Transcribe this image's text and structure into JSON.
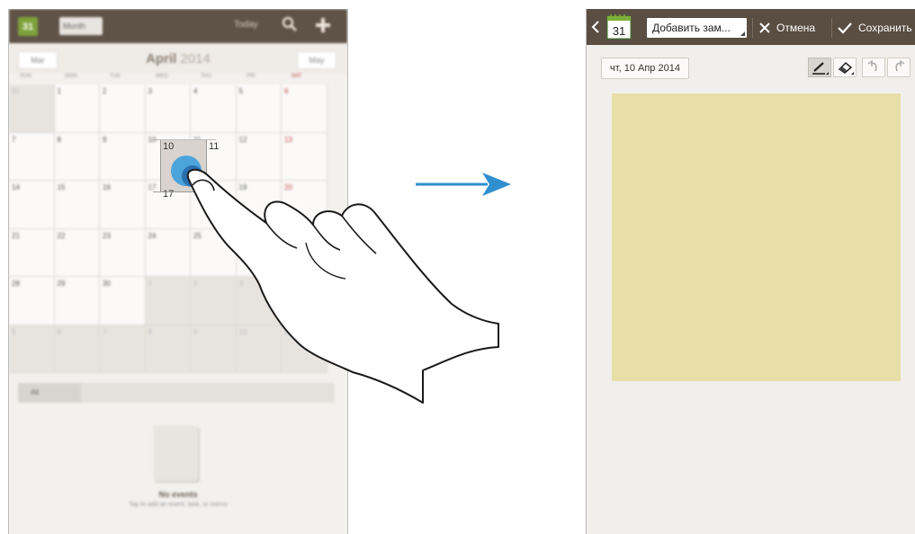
{
  "calendar": {
    "app_icon_day": "31",
    "view_selector": "Month",
    "today_label": "Today",
    "prev_month": "Mar",
    "next_month": "May",
    "month_title": "April",
    "month_year": "2014",
    "weekdays": [
      "SUN",
      "MON",
      "TUE",
      "WED",
      "THU",
      "FRI",
      "SAT"
    ],
    "weeks": [
      [
        "31",
        "1",
        "2",
        "3",
        "4",
        "5",
        "6"
      ],
      [
        "7",
        "8",
        "9",
        "10",
        "11",
        "12",
        "13"
      ],
      [
        "14",
        "15",
        "16",
        "17",
        "18",
        "19",
        "20"
      ],
      [
        "21",
        "22",
        "23",
        "24",
        "25",
        "26",
        "27"
      ],
      [
        "28",
        "29",
        "30",
        "1",
        "2",
        "3",
        "4"
      ],
      [
        "5",
        "6",
        "7",
        "8",
        "9",
        "10",
        "11"
      ]
    ],
    "selected_day": "10",
    "filter_label": "All",
    "no_events_title": "No events",
    "no_events_text": "Tap to add an event, task, or memo",
    "accent_color": "#7da23b"
  },
  "memo": {
    "app_icon_day": "31",
    "title_field": "Добавить зам...",
    "cancel_label": "Отмена",
    "save_label": "Сохранить",
    "date_label": "чт, 10 Апр 2014",
    "tools": [
      "pen-icon",
      "eraser-icon",
      "undo-icon",
      "redo-icon"
    ],
    "paper_color": "#e7dfa5"
  }
}
